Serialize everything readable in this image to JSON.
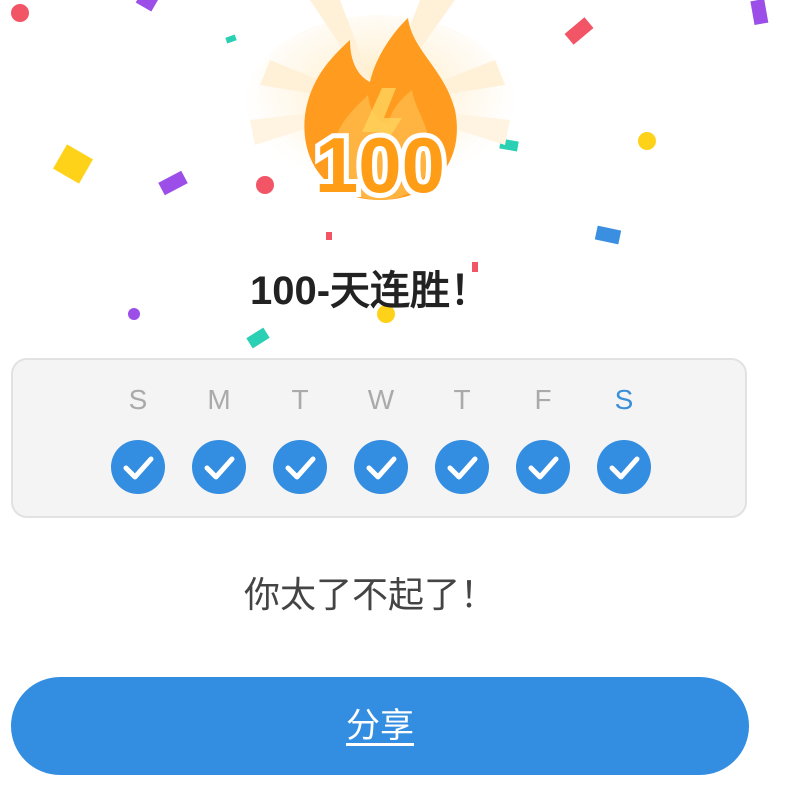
{
  "badge": {
    "number": "100",
    "icon": "fire-icon",
    "colors": {
      "flame": "#ff9b1e",
      "flame_dark": "#f08a0c",
      "number": "#ff9e16"
    }
  },
  "title": "100-天连胜！",
  "week": {
    "days": [
      {
        "letter": "S",
        "completed": true,
        "today": false
      },
      {
        "letter": "M",
        "completed": true,
        "today": false
      },
      {
        "letter": "T",
        "completed": true,
        "today": false
      },
      {
        "letter": "W",
        "completed": true,
        "today": false
      },
      {
        "letter": "T",
        "completed": true,
        "today": false
      },
      {
        "letter": "F",
        "completed": true,
        "today": false
      },
      {
        "letter": "S",
        "completed": true,
        "today": true
      }
    ]
  },
  "message": "你太了不起了！",
  "share_button": {
    "label": "分享"
  },
  "colors": {
    "accent": "#338de0",
    "card_bg": "#f4f4f4",
    "title": "#222222"
  }
}
